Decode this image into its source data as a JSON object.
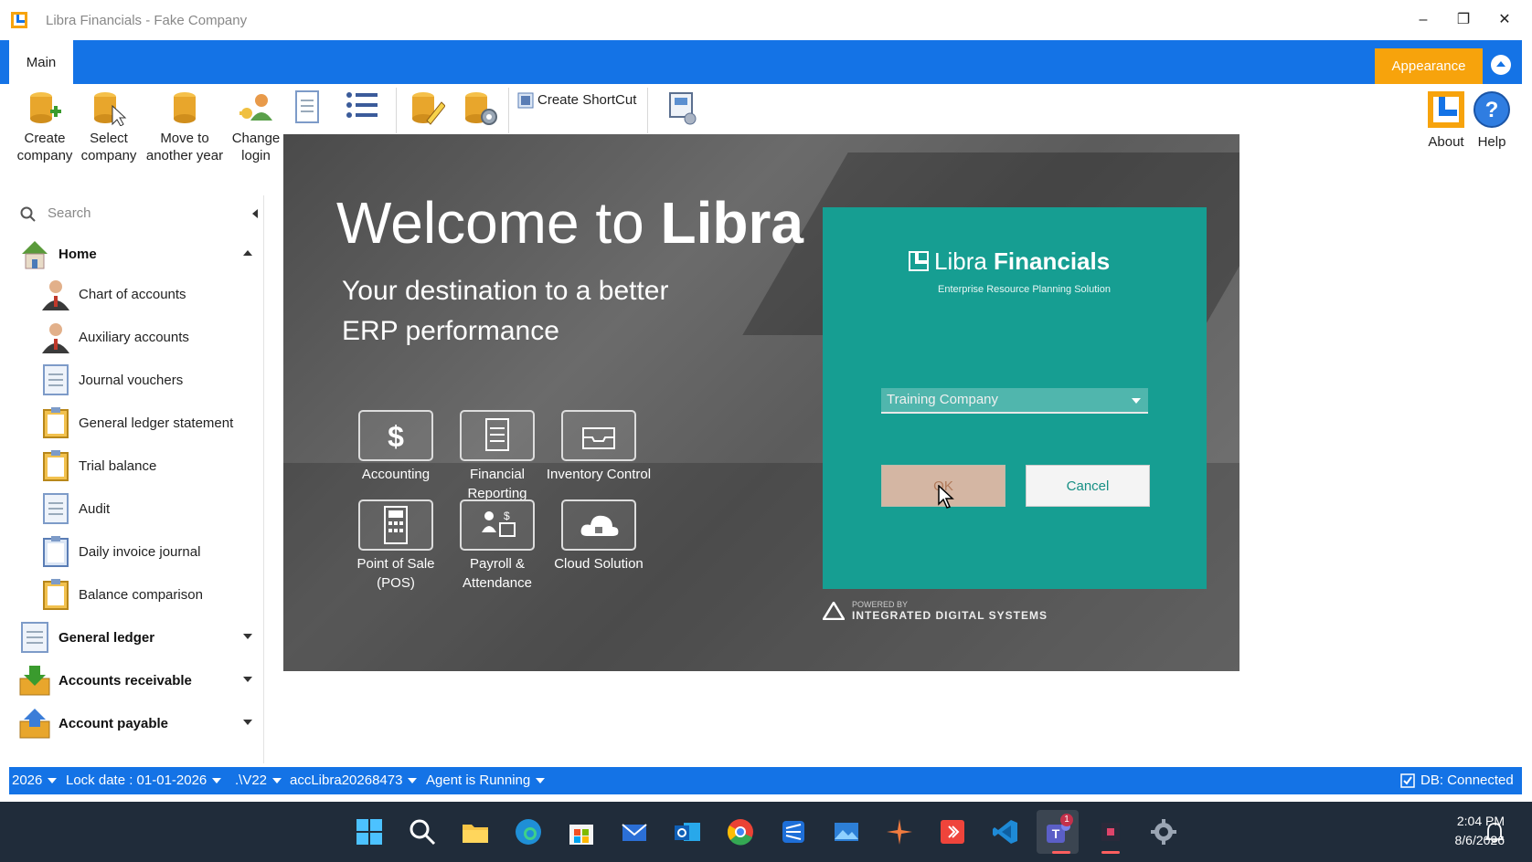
{
  "window": {
    "title": "Libra Financials - Fake Company"
  },
  "ribbon_tabs": {
    "main": "Main",
    "appearance": "Appearance"
  },
  "ribbon": {
    "create_company": "Create company",
    "select_company": "Select company",
    "move_year": "Move to another year",
    "change_login": "Change login",
    "create_shortcut": "Create ShortCut",
    "about": "About",
    "help": "Help"
  },
  "sidebar": {
    "search_placeholder": "Search",
    "home": "Home",
    "items": [
      "Chart of accounts",
      "Auxiliary accounts",
      "Journal vouchers",
      "General ledger statement",
      "Trial balance",
      "Audit",
      "Daily invoice journal",
      "Balance comparison"
    ],
    "groups": [
      "General ledger",
      "Accounts receivable",
      "Account payable"
    ]
  },
  "welcome": {
    "prefix": "Welcome to ",
    "brand": "Libra",
    "tagline": "Your destination to a better ERP performance",
    "features": [
      "Accounting",
      "Financial Reporting",
      "Inventory Control",
      "Point of Sale (POS)",
      "Payroll & Attendance",
      "Cloud Solution"
    ]
  },
  "login": {
    "brand_light": "Libra ",
    "brand_bold": "Financials",
    "subtitle": "Enterprise Resource Planning Solution",
    "company": "Training Company",
    "ok": "OK",
    "cancel": "Cancel",
    "powered_by": "POWERED BY",
    "vendor": "INTEGRATED DIGITAL SYSTEMS"
  },
  "statusbar": {
    "year": "2026",
    "lock_date": "Lock date : 01-01-2026",
    "server": ".\\V22",
    "database": "accLibra20268473",
    "agent": "Agent is Running",
    "db_status": "DB: Connected"
  },
  "taskbar": {
    "time": "2:04 PM",
    "date": "8/6/2026",
    "teams_badge": "1"
  },
  "colors": {
    "accent": "#1473e6",
    "appearance": "#f7a30c",
    "login_panel": "#169e92"
  }
}
